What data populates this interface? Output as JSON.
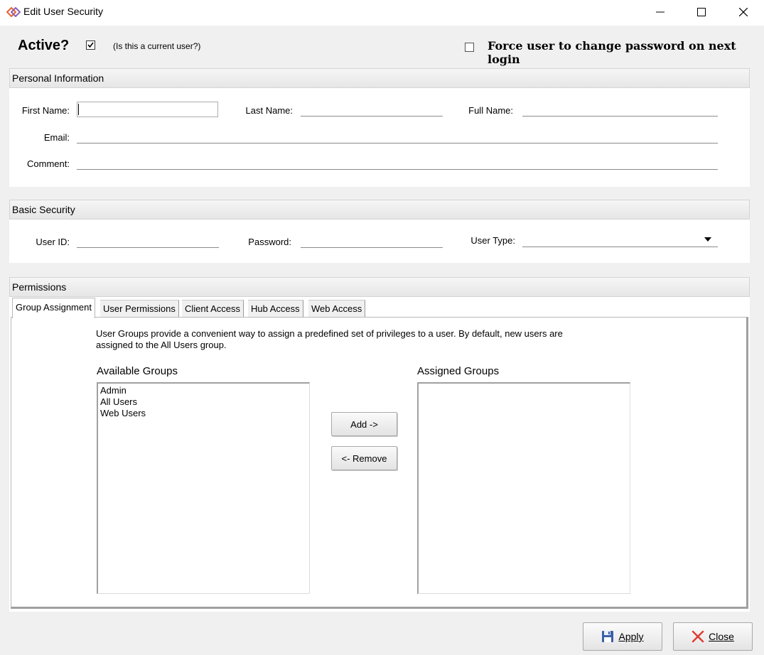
{
  "window": {
    "title": "Edit User Security",
    "icon": "diamond-logo-icon",
    "controls": [
      "minimize-icon",
      "maximize-icon",
      "close-icon"
    ]
  },
  "top": {
    "active_label": "Active?",
    "active_checked": true,
    "active_hint": "(Is this a current user?)",
    "force_label": "Force user to change password on next login",
    "force_checked": false
  },
  "personal": {
    "header": "Personal Information",
    "first_name_label": "First Name:",
    "first_name_value": "",
    "last_name_label": "Last Name:",
    "last_name_value": "",
    "full_name_label": "Full Name:",
    "full_name_value": "",
    "email_label": "Email:",
    "email_value": "",
    "comment_label": "Comment:",
    "comment_value": ""
  },
  "basic": {
    "header": "Basic Security",
    "user_id_label": "User ID:",
    "user_id_value": "",
    "password_label": "Password:",
    "password_value": "",
    "user_type_label": "User Type:",
    "user_type_value": ""
  },
  "permissions": {
    "header": "Permissions",
    "tabs": [
      {
        "label": "Group Assignment",
        "active": true
      },
      {
        "label": "User Permissions",
        "active": false
      },
      {
        "label": "Client Access",
        "active": false
      },
      {
        "label": "Hub Access",
        "active": false
      },
      {
        "label": "Web Access",
        "active": false
      }
    ],
    "description": "User Groups provide a convenient way to assign a predefined set of privileges to a user.  By default, new users are assigned to the All Users group.",
    "available_title": "Available Groups",
    "available_items": [
      "Admin",
      "All Users",
      "Web Users"
    ],
    "assigned_title": "Assigned Groups",
    "assigned_items": [],
    "add_label": "Add ->",
    "remove_label": "<- Remove"
  },
  "footer": {
    "apply_label": "Apply",
    "close_label": "Close",
    "apply_icon": "floppy-disk-icon",
    "close_icon": "red-x-icon"
  },
  "colors": {
    "logo_orange": "#e8622c",
    "logo_purple": "#8b5fb4",
    "close_red": "#e03a2e",
    "disk_blue": "#3b5fa8"
  }
}
